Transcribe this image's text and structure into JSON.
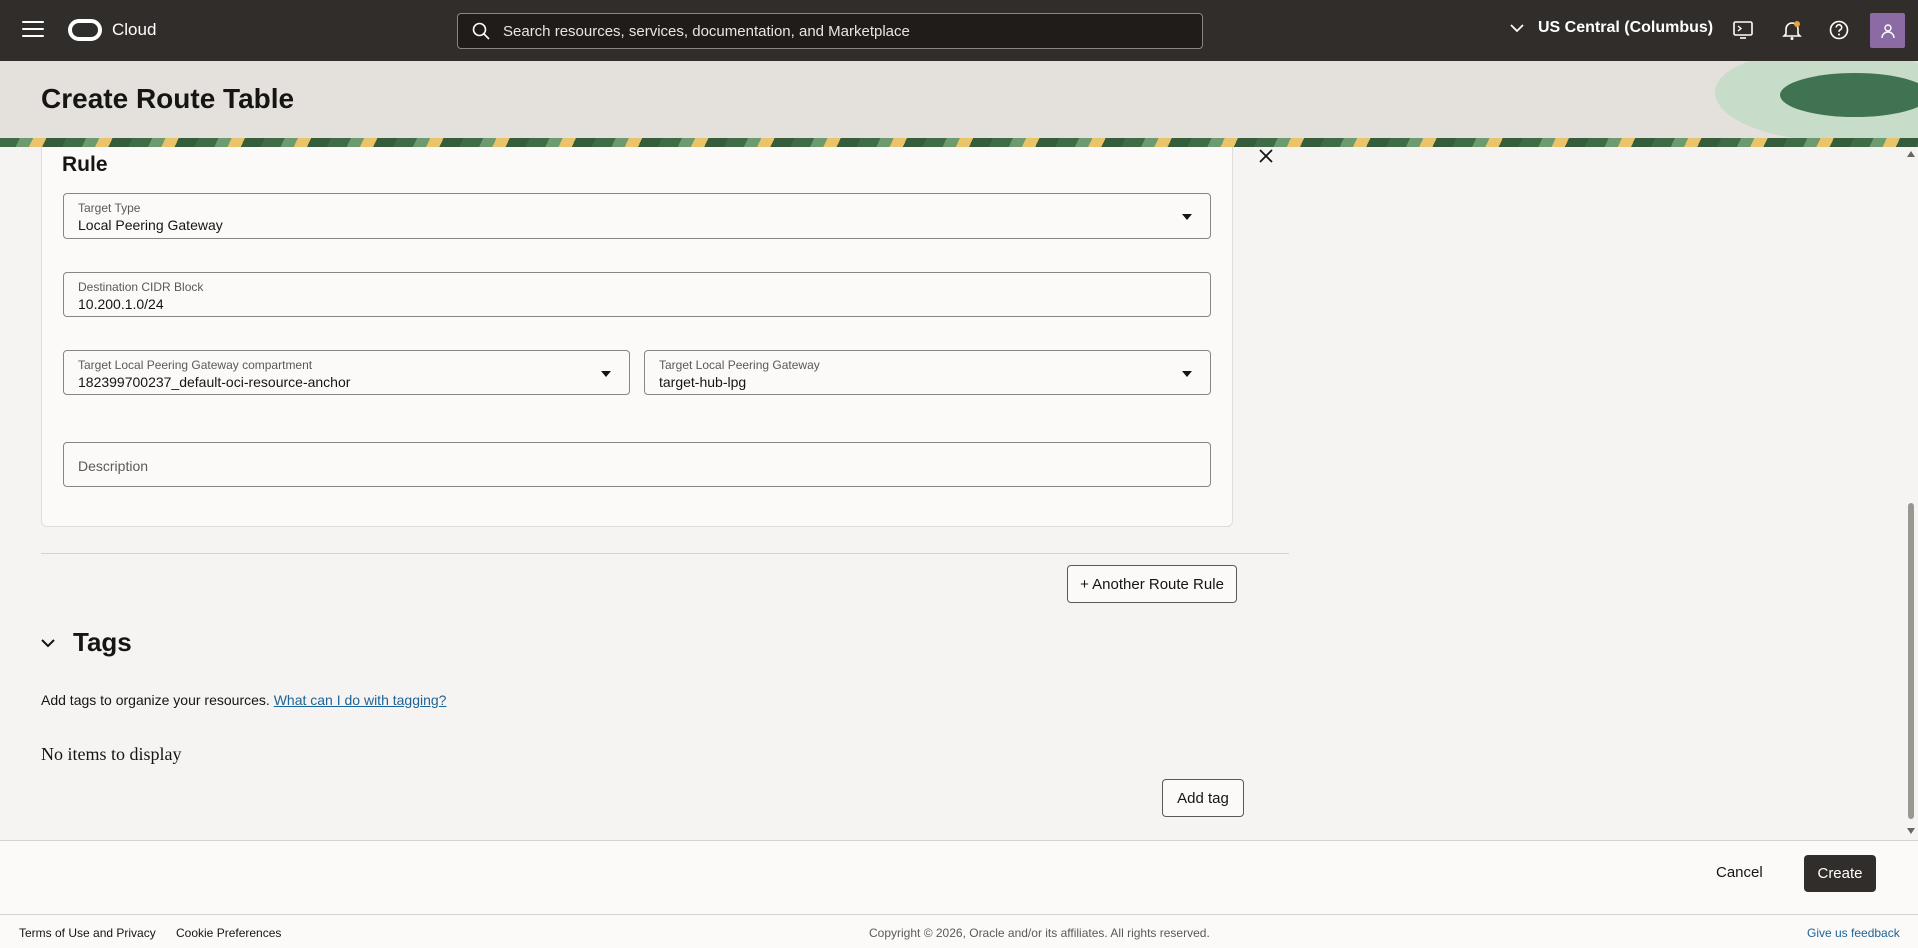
{
  "topbar": {
    "brand": "Cloud",
    "search_placeholder": "Search resources, services, documentation, and Marketplace",
    "region": "US Central (Columbus)"
  },
  "page": {
    "title": "Create Route Table"
  },
  "rule": {
    "heading": "Rule",
    "target_type": {
      "label": "Target Type",
      "value": "Local Peering Gateway"
    },
    "destination_cidr": {
      "label": "Destination CIDR Block",
      "value": "10.200.1.0/24"
    },
    "lpg_compartment": {
      "label": "Target Local Peering Gateway compartment",
      "value": "182399700237_default-oci-resource-anchor"
    },
    "lpg": {
      "label": "Target Local Peering Gateway",
      "value": "target-hub-lpg"
    },
    "description": {
      "placeholder": "Description"
    }
  },
  "another_rule_button": "+ Another Route Rule",
  "tags": {
    "heading": "Tags",
    "description": "Add tags to organize your resources.",
    "help_link": "What can I do with tagging?",
    "empty_text": "No items to display",
    "add_button": "Add tag"
  },
  "actions": {
    "cancel": "Cancel",
    "create": "Create"
  },
  "footer": {
    "terms": "Terms of Use and Privacy",
    "cookie": "Cookie Preferences",
    "copyright": "Copyright © 2026, Oracle and/or its affiliates. All rights reserved.",
    "feedback": "Give us feedback"
  },
  "icons": [
    "hamburger-icon",
    "oracle-logo-icon",
    "search-icon",
    "chevron-down-icon",
    "cloud-shell-icon",
    "bell-icon",
    "help-icon",
    "user-icon",
    "close-icon",
    "caret-down-icon"
  ]
}
